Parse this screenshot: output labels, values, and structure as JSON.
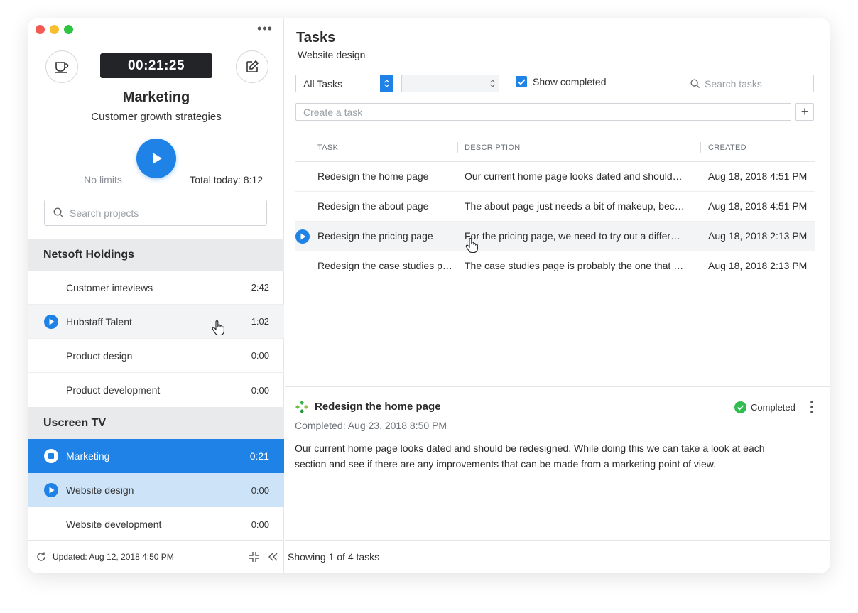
{
  "sidebar": {
    "timer": "00:21:25",
    "project_title": "Marketing",
    "project_subtitle": "Customer growth strategies",
    "no_limits": "No limits",
    "total_today": "Total today: 8:12",
    "search_placeholder": "Search projects",
    "groups": [
      {
        "name": "Netsoft Holdings",
        "items": [
          {
            "label": "Customer inteviews",
            "time": "2:42"
          },
          {
            "label": "Hubstaff Talent",
            "time": "1:02"
          },
          {
            "label": "Product design",
            "time": "0:00"
          },
          {
            "label": "Product development",
            "time": "0:00"
          }
        ]
      },
      {
        "name": "Uscreen TV",
        "items": [
          {
            "label": "Marketing",
            "time": "0:21"
          },
          {
            "label": "Website design",
            "time": "0:00"
          },
          {
            "label": "Website development",
            "time": "0:00"
          }
        ]
      }
    ],
    "footer_updated": "Updated: Aug 12, 2018 4:50 PM"
  },
  "tasks": {
    "title": "Tasks",
    "subtitle": "Website design",
    "filter_selected": "All Tasks",
    "secondary_select": "",
    "show_completed_label": "Show completed",
    "search_placeholder": "Search tasks",
    "create_placeholder": "Create a task",
    "columns": [
      "TASK",
      "DESCRIPTION",
      "CREATED"
    ],
    "rows": [
      {
        "task": "Redesign the home page",
        "description": "Our current home page looks dated and should…",
        "created": "Aug 18, 2018 4:51 PM"
      },
      {
        "task": "Redesign the about page",
        "description": "The about page just needs a bit of makeup, bec…",
        "created": "Aug 18, 2018 4:51 PM"
      },
      {
        "task": "Redesign the pricing page",
        "description": "For the pricing page, we need to try out a differe…",
        "created": "Aug 18, 2018 2:13 PM"
      },
      {
        "task": "Redesign the case studies pa…",
        "description": "The case studies page is probably the one that …",
        "created": "Aug 18, 2018 2:13 PM"
      }
    ],
    "detail": {
      "title": "Redesign the home page",
      "status": "Completed",
      "completed_at": "Completed: Aug 23, 2018 8:50 PM",
      "description": "Our current home page looks dated and should be redesigned. While doing this we can take a look at each section and see if there are any improvements that can be made from a marketing point of view."
    },
    "footer": "Showing 1 of 4 tasks"
  },
  "colors": {
    "accent": "#1f82e6",
    "selected_row": "#cde3f8",
    "completed_green": "#2dbe4f",
    "timer_bg": "#222428"
  }
}
